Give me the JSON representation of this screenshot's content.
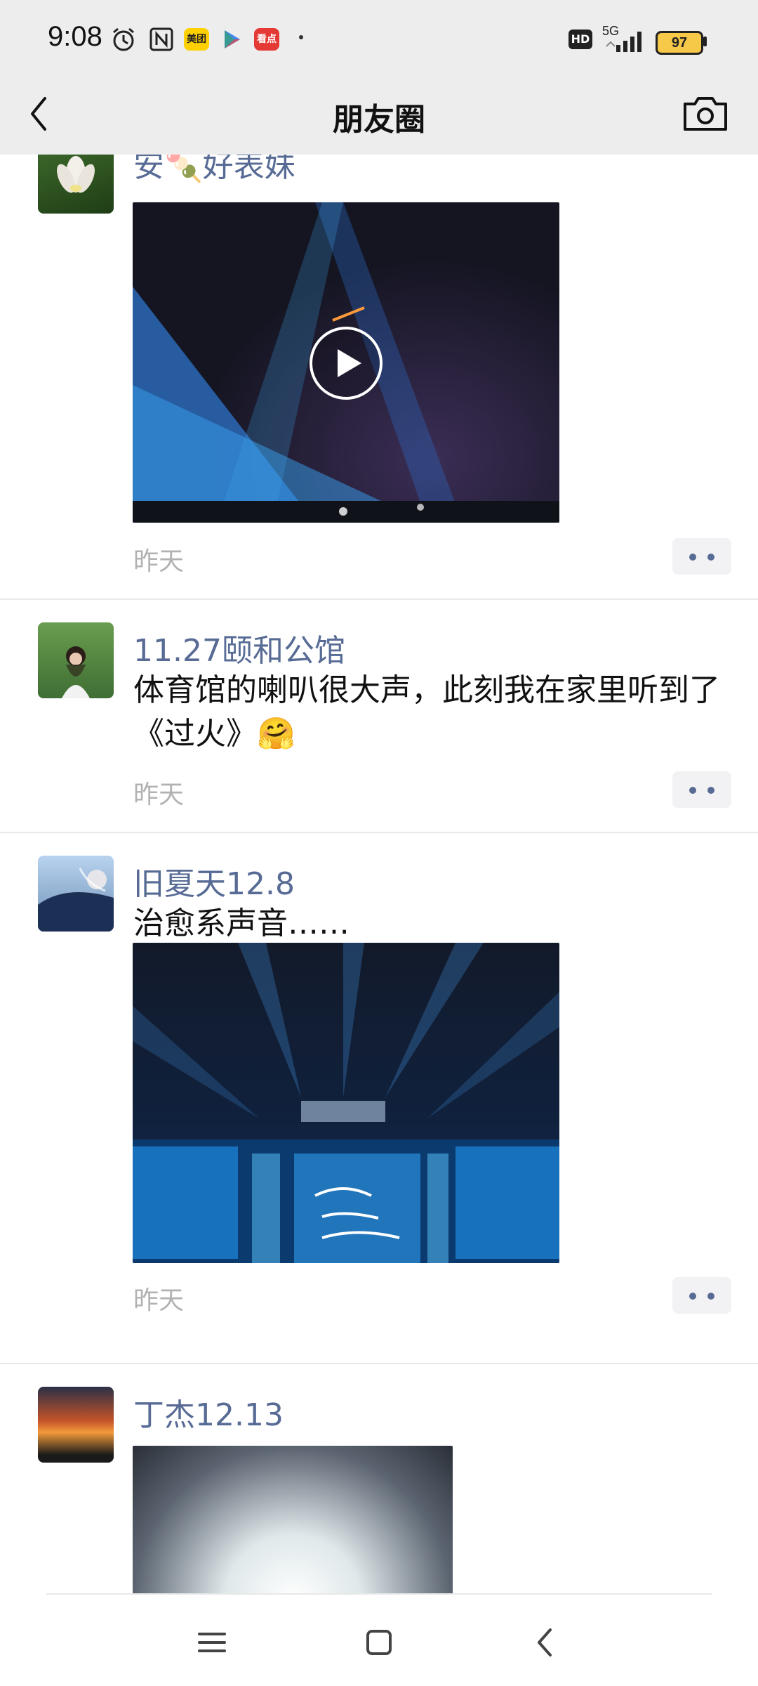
{
  "status_bar": {
    "time": "9:08",
    "apps": [
      "美团",
      "看点"
    ],
    "hd": "HD",
    "network": "5G",
    "battery": "97"
  },
  "header": {
    "title": "朋友圈"
  },
  "posts": [
    {
      "name": "安🍡好表妹",
      "time": "昨天",
      "has_video": true
    },
    {
      "name": "11.27颐和公馆",
      "text": "体育馆的喇叭很大声，此刻我在家里听到了《过火》🤗",
      "time": "昨天"
    },
    {
      "name": "旧夏天12.8",
      "text": "治愈系声音……",
      "time": "昨天"
    },
    {
      "name": "丁杰12.13"
    }
  ],
  "colors": {
    "link_name": "#576b95",
    "header_bg": "#ededed",
    "time_gray": "#b2b2b2"
  }
}
